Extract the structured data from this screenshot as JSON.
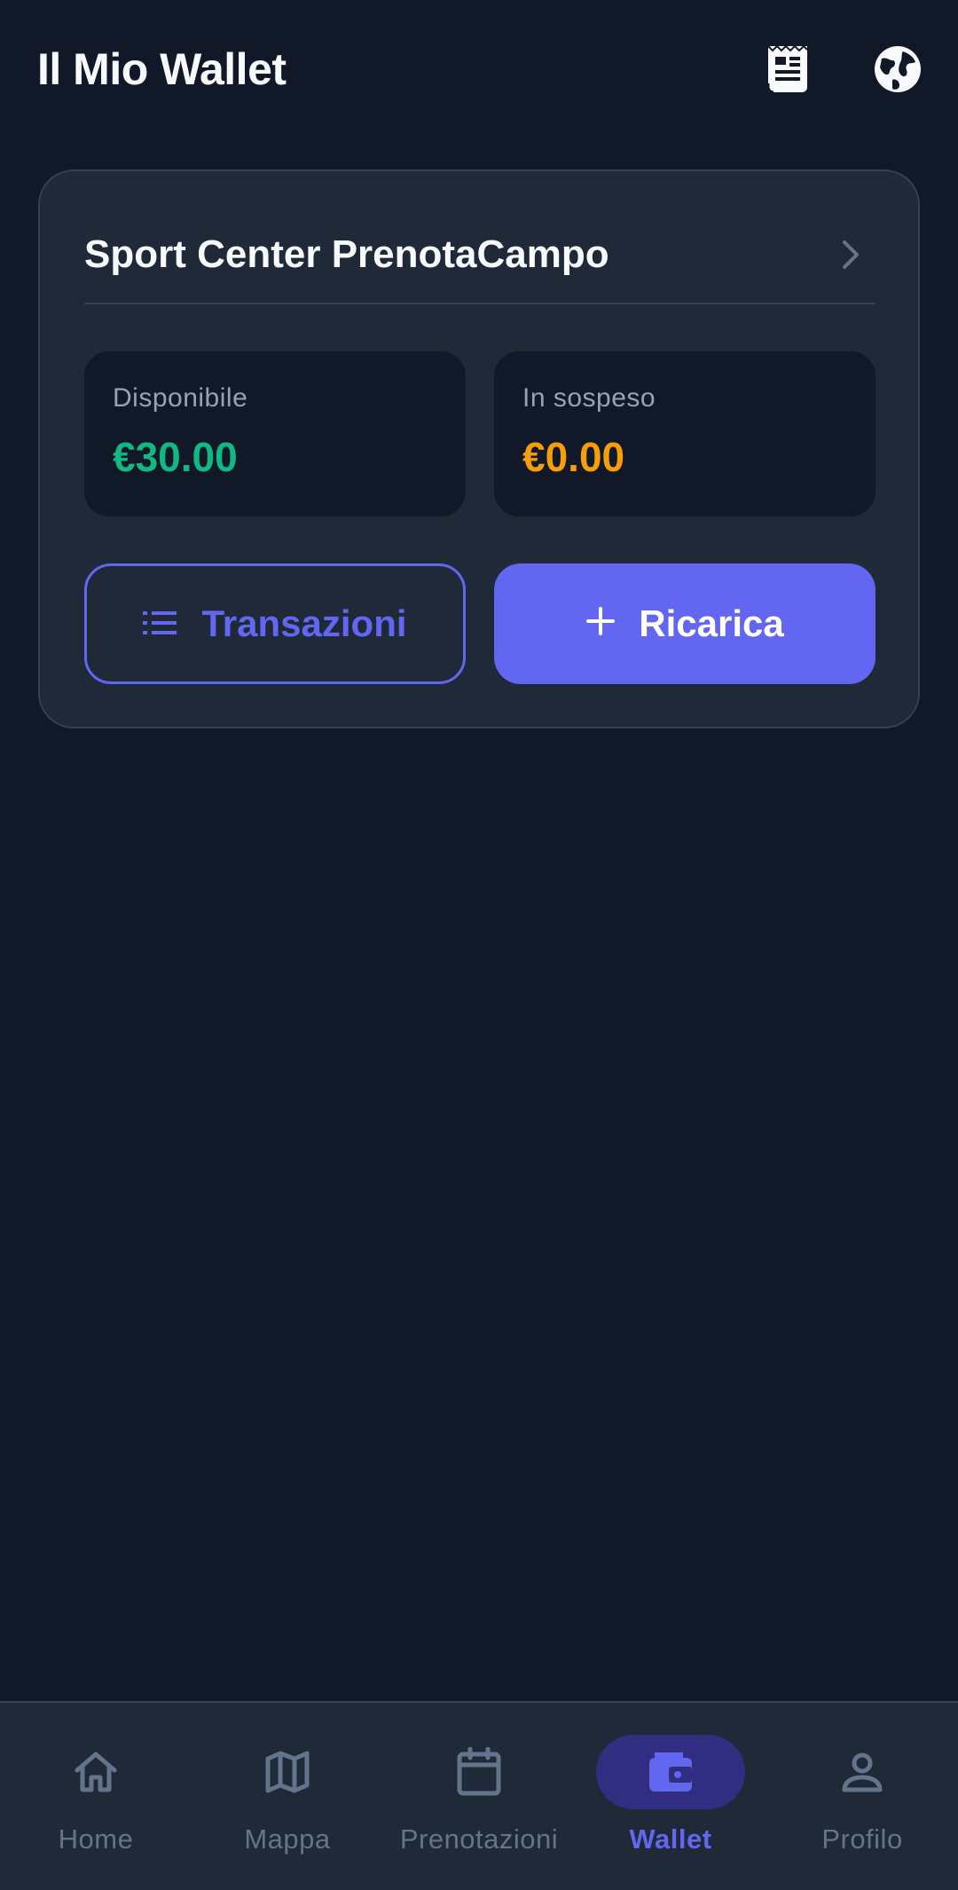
{
  "header": {
    "title": "Il Mio Wallet",
    "receipt_icon": "receipt-icon",
    "globe_icon": "globe-icon"
  },
  "wallet_card": {
    "title": "Sport Center PrenotaCampo",
    "available": {
      "label": "Disponibile",
      "amount": "€30.00",
      "color": "#10b981"
    },
    "pending": {
      "label": "In sospeso",
      "amount": "€0.00",
      "color": "#f59e0b"
    },
    "transactions_button": "Transazioni",
    "recharge_button": "Ricarica"
  },
  "bottom_nav": {
    "items": [
      {
        "label": "Home",
        "icon": "home-icon",
        "active": false
      },
      {
        "label": "Mappa",
        "icon": "map-icon",
        "active": false
      },
      {
        "label": "Prenotazioni",
        "icon": "calendar-icon",
        "active": false
      },
      {
        "label": "Wallet",
        "icon": "wallet-icon",
        "active": true
      },
      {
        "label": "Profilo",
        "icon": "profile-icon",
        "active": false
      }
    ]
  },
  "colors": {
    "background": "#111827",
    "surface": "#1f2937",
    "accent": "#6366f1",
    "success": "#10b981",
    "warning": "#f59e0b"
  }
}
